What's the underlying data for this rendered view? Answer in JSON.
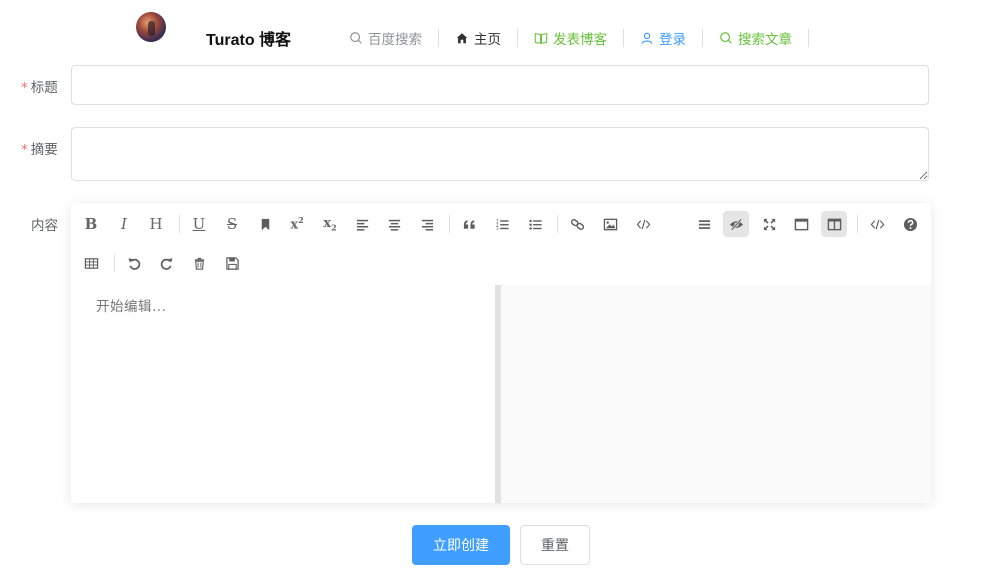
{
  "header": {
    "brand": "Turato 博客",
    "nav": [
      {
        "label": "百度搜索",
        "icon": "search-icon",
        "color": "#909399"
      },
      {
        "label": "主页",
        "icon": "home-icon",
        "color": "#303133"
      },
      {
        "label": "发表博客",
        "icon": "book-icon",
        "color": "#67c23a"
      },
      {
        "label": "登录",
        "icon": "user-icon",
        "color": "#409eff"
      },
      {
        "label": "搜索文章",
        "icon": "search-icon",
        "color": "#67c23a"
      }
    ]
  },
  "form": {
    "title": {
      "label": "标题",
      "required_mark": "*",
      "value": ""
    },
    "summary": {
      "label": "摘要",
      "required_mark": "*",
      "value": ""
    },
    "content": {
      "label": "内容"
    }
  },
  "editor": {
    "placeholder": "开始编辑...",
    "toolbar_row1": [
      "bold-icon",
      "italic-icon",
      "header-icon",
      "underline-icon",
      "strikethrough-icon",
      "mark-icon",
      "superscript-icon",
      "subscript-icon",
      "align-left-icon",
      "align-center-icon",
      "align-right-icon",
      "quote-icon",
      "ordered-list-icon",
      "unordered-list-icon",
      "link-icon",
      "image-icon",
      "code-icon",
      "navigation-icon",
      "preview-icon",
      "fullscreen-icon",
      "read-mode-icon",
      "subfield-icon",
      "html-code-icon",
      "help-icon"
    ],
    "toolbar_row2": [
      "table-icon",
      "undo-icon",
      "redo-icon",
      "trash-icon",
      "save-icon"
    ],
    "active_tools": [
      "preview-icon",
      "subfield-icon"
    ]
  },
  "actions": {
    "submit_label": "立即创建",
    "reset_label": "重置"
  },
  "colors": {
    "primary": "#409eff",
    "danger": "#f56c6c",
    "success": "#67c23a"
  }
}
